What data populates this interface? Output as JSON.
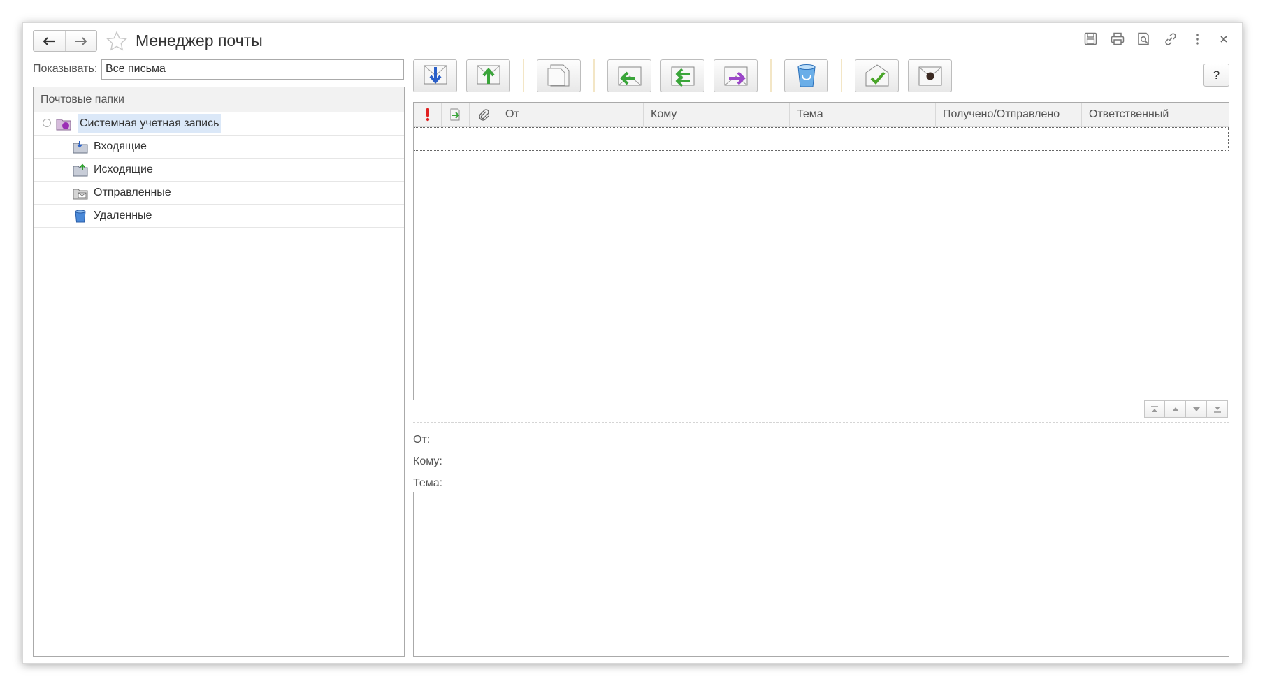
{
  "header": {
    "title": "Менеджер почты"
  },
  "filter": {
    "label": "Показывать:",
    "value": "Все письма"
  },
  "folders": {
    "header": "Почтовые папки",
    "root": "Системная учетная запись",
    "items": [
      {
        "label": "Входящие",
        "icon": "inbox-folder-icon"
      },
      {
        "label": "Исходящие",
        "icon": "outbox-folder-icon"
      },
      {
        "label": "Отправленные",
        "icon": "sent-folder-icon"
      },
      {
        "label": "Удаленные",
        "icon": "deleted-folder-icon"
      }
    ]
  },
  "toolbar": {
    "help_label": "?"
  },
  "mail_table": {
    "columns": [
      "От",
      "Кому",
      "Тема",
      "Получено/Отправлено",
      "Ответственный"
    ]
  },
  "preview": {
    "from_label": "От:",
    "to_label": "Кому:",
    "subject_label": "Тема:"
  },
  "colors": {
    "selection": "#dbe8f8",
    "importance": "#e02020",
    "separator": "#f3e6c6"
  }
}
